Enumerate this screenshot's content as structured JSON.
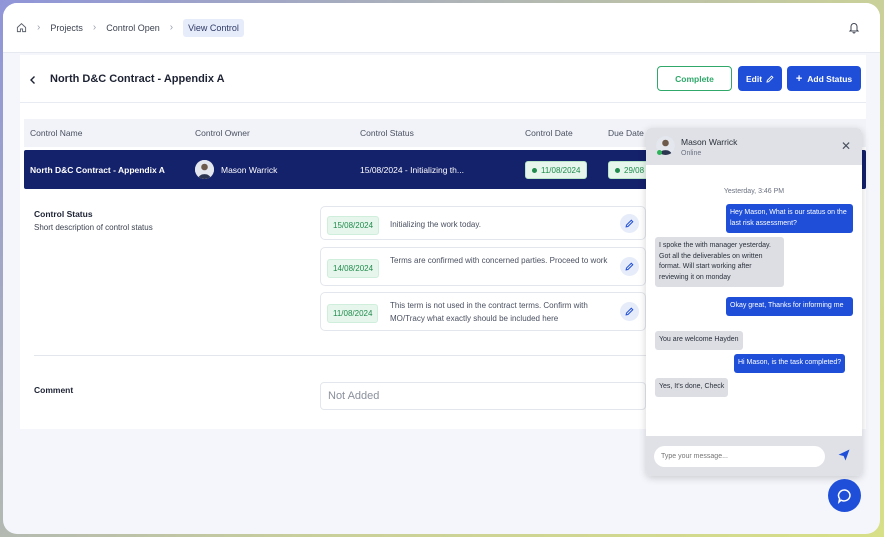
{
  "breadcrumb": {
    "items": [
      "Projects",
      "Control Open"
    ],
    "active": "View Control"
  },
  "header": {
    "title": "North D&C Contract - Appendix A",
    "complete_label": "Complete",
    "edit_label": "Edit",
    "add_status_label": "Add Status"
  },
  "table": {
    "columns": [
      "Control Name",
      "Control Owner",
      "Control Status",
      "Control Date",
      "Due Date"
    ],
    "row": {
      "name": "North D&C Contract - Appendix A",
      "owner": "Mason Warrick",
      "status": "15/08/2024 - Initializing th...",
      "control_date": "11/08/2024",
      "due_date": "29/08"
    }
  },
  "control_status": {
    "label": "Control Status",
    "description": "Short description of control status",
    "entries": [
      {
        "date": "15/08/2024",
        "text": "Initializing the work today."
      },
      {
        "date": "14/08/2024",
        "text": "Terms are confirmed with concerned parties. Proceed to work"
      },
      {
        "date": "11/08/2024",
        "text": "This term is not used in the contract terms. Confirm with MO/Tracy what exactly should be included here"
      }
    ]
  },
  "comment": {
    "label": "Comment",
    "value": "Not Added"
  },
  "chat": {
    "name": "Mason Warrick",
    "status": "Online",
    "timestamp": "Yesterday, 3:46 PM",
    "messages": [
      {
        "dir": "out",
        "text": "Hey Mason, What is our status on the last risk assessment?"
      },
      {
        "dir": "in",
        "text": "I spoke the with manager yesterday. Got all the deliverables on written format. Will start working after reviewing it on monday"
      },
      {
        "dir": "out",
        "text": "Okay great, Thanks for informing me"
      },
      {
        "dir": "in",
        "text": "You are welcome Hayden"
      },
      {
        "dir": "out",
        "text": "Hi Mason, is the task completed?"
      },
      {
        "dir": "in",
        "text": "Yes, It's done, Check"
      }
    ],
    "input_placeholder": "Type your message..."
  },
  "colors": {
    "primary": "#1f4fd9",
    "selected_row": "#14216b",
    "success": "#2fa86a"
  },
  "icons": [
    "home-icon",
    "chevron-right-icon",
    "bell-icon",
    "back-arrow-icon",
    "pencil-icon",
    "plus-icon",
    "close-icon",
    "send-icon",
    "chat-bubble-icon"
  ]
}
